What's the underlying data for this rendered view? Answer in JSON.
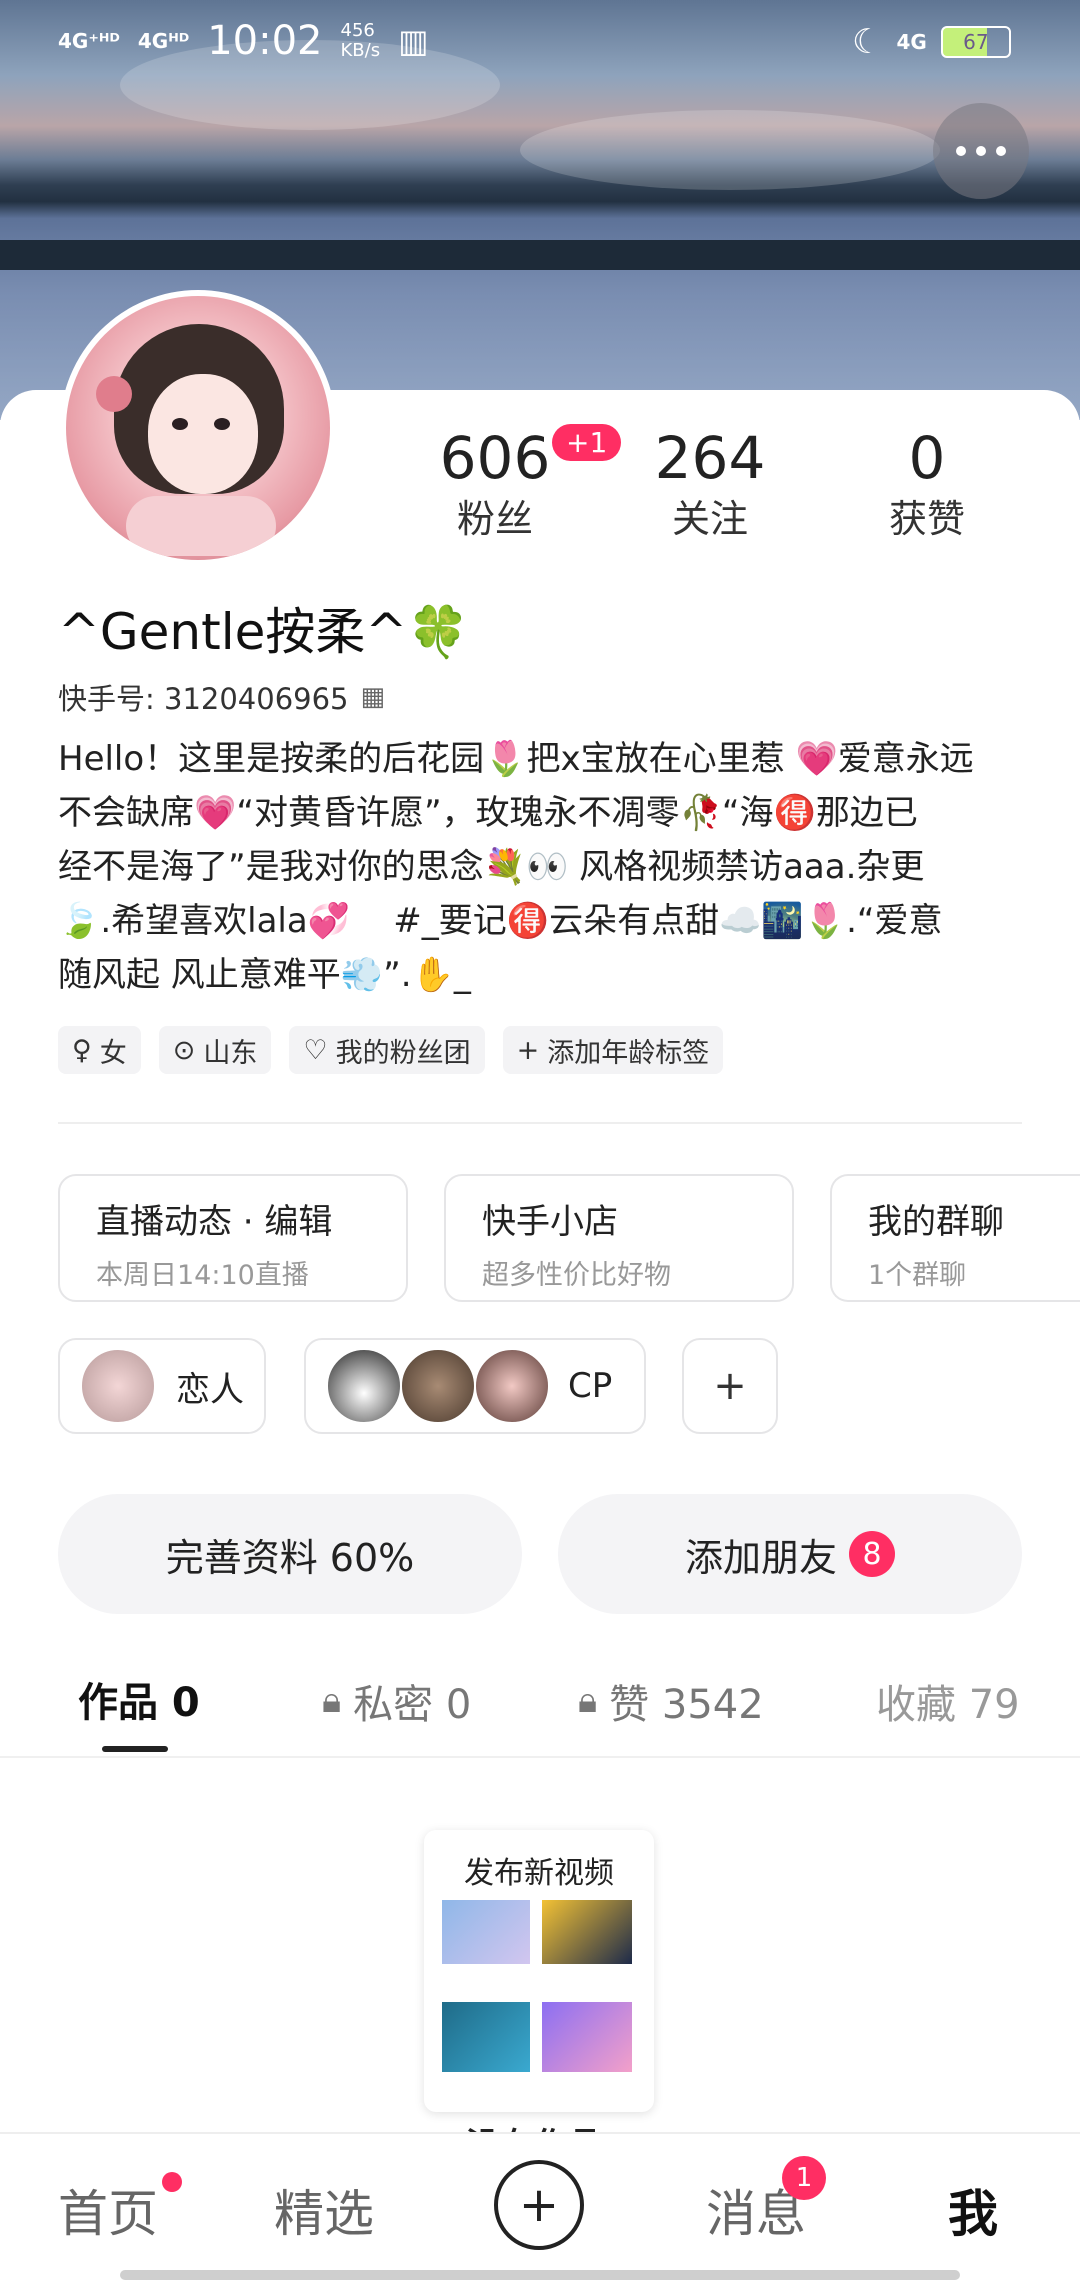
{
  "status_bar": {
    "net1": "4G⁺ᴴᴰ",
    "net2": "4Gᴴᴰ",
    "time": "10:02",
    "speed_value": "456",
    "speed_unit": "KB/s",
    "net3": "4G",
    "battery": "67"
  },
  "profile": {
    "name": "^Gentle按柔^🍀",
    "kuaishou_id": "快手号: 3120406965",
    "stats": [
      {
        "value": "606",
        "label": "粉丝",
        "badge": "+1"
      },
      {
        "value": "264",
        "label": "关注"
      },
      {
        "value": "0",
        "label": "获赞"
      }
    ],
    "bio": "Hello！这里是按柔的后花园🌷把x宝放在心里惹 💗爱意永远\n不会缺席💗“对黄昏许愿”，玫瑰永不凋零🥀“海🉐那边已\n经不是海了”是我对你的思念💐👀 风格视频禁访aaa.杂更\n🍃.希望喜欢lala💞    #_要记🉐云朵有点甜☁️🌃🌷.“爱意\n随风起 风止意难平💨”.✋_",
    "tags": [
      {
        "icon": "♀",
        "label": "女"
      },
      {
        "icon": "⊙",
        "label": "山东"
      },
      {
        "icon": "♡",
        "label": "我的粉丝团"
      },
      {
        "icon": "+",
        "label": "添加年龄标签"
      }
    ]
  },
  "info_cards": [
    {
      "title": "直播动态 · 编辑",
      "sub": "本周日14:10直播"
    },
    {
      "title": "快手小店",
      "sub": "超多性价比好物"
    },
    {
      "title": "我的群聊",
      "sub": "1个群聊"
    }
  ],
  "relations": {
    "lover_label": "恋人",
    "cp_label": "CP",
    "add_symbol": "+"
  },
  "actions": {
    "complete_label": "完善资料 60%",
    "add_friend_label": "添加朋友",
    "add_friend_count": "8"
  },
  "tabs": [
    {
      "label": "作品 0"
    },
    {
      "label": "私密 0"
    },
    {
      "label": "赞 3542"
    },
    {
      "label": "收藏 79"
    }
  ],
  "empty_state": {
    "publish_title": "发布新视频",
    "hint_partial": "没有作品"
  },
  "bottom_nav": [
    {
      "label": "首页"
    },
    {
      "label": "精选"
    },
    {
      "label": "+"
    },
    {
      "label": "消息",
      "badge": "1"
    },
    {
      "label": "我"
    }
  ],
  "colors": {
    "accent": "#ff2e63",
    "text": "#222222",
    "muted": "#999999"
  }
}
